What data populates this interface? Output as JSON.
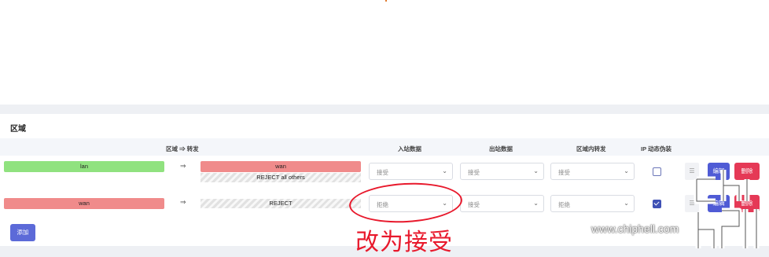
{
  "section": {
    "title": "区域"
  },
  "table": {
    "headers": {
      "forwarding": "区域 ⇒ 转发",
      "input": "入站数据",
      "output": "出站数据",
      "intra": "区域内转发",
      "masq": "IP 动态伪装"
    },
    "rows": [
      {
        "zone": "lan",
        "arrow": "⇒",
        "dest": "wan",
        "dest_note": "REJECT all others",
        "input": "接受",
        "output": "接受",
        "intra": "接受",
        "masq": false,
        "edit": "编辑",
        "delete": "删除"
      },
      {
        "zone": "wan",
        "arrow": "⇒",
        "dest": "REJECT",
        "input": "拒绝",
        "output": "接受",
        "intra": "拒绝",
        "masq": true,
        "edit": "编辑",
        "delete": "删除"
      }
    ]
  },
  "add_button": "添加",
  "annotation": {
    "text": "改为接受"
  },
  "watermark": {
    "text": "www.chiphell.com"
  },
  "icons": {
    "handle": "drag-handle-icon",
    "chevron": "chevron-down-icon"
  },
  "colors": {
    "zone_green": "#90e27f",
    "zone_red": "#f08b8b",
    "primary": "#4f5bd5",
    "danger": "#e53956",
    "annotation": "#e8192c"
  }
}
